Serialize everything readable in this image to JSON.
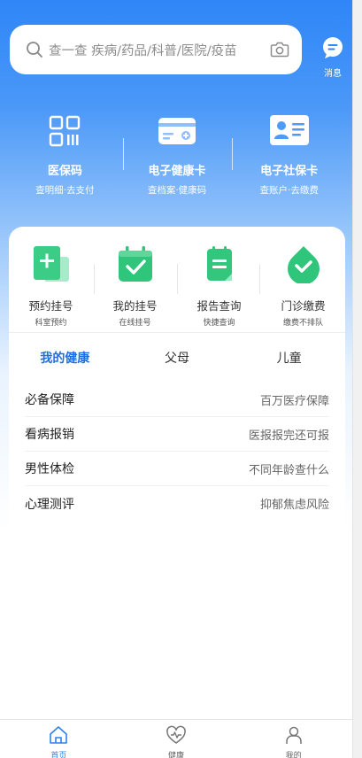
{
  "search": {
    "placeholder": "查一查 疾病/药品/科普/医院/疫苗"
  },
  "message": {
    "label": "消息"
  },
  "cards": [
    {
      "title": "医保码",
      "subtitle": "查明细·去支付",
      "icon": "qr-code-icon"
    },
    {
      "title": "电子健康卡",
      "subtitle": "查档案·健康码",
      "icon": "health-card-icon"
    },
    {
      "title": "电子社保卡",
      "subtitle": "查账户·去缴费",
      "icon": "social-security-card-icon"
    }
  ],
  "quick_actions": [
    {
      "title": "预约挂号",
      "subtitle": "科室预约",
      "icon": "appointment-icon"
    },
    {
      "title": "我的挂号",
      "subtitle": "在线挂号",
      "icon": "my-registration-icon"
    },
    {
      "title": "报告查询",
      "subtitle": "快捷查询",
      "icon": "report-icon"
    },
    {
      "title": "门诊缴费",
      "subtitle": "缴费不排队",
      "icon": "payment-icon"
    }
  ],
  "tabs": [
    {
      "label": "我的健康",
      "active": true
    },
    {
      "label": "父母",
      "active": false
    },
    {
      "label": "儿童",
      "active": false
    }
  ],
  "health_rows": [
    {
      "title": "必备保障",
      "desc": "百万医疗保障"
    },
    {
      "title": "看病报销",
      "desc": "医报报完还可报"
    },
    {
      "title": "男性体检",
      "desc": "不同年龄查什么"
    },
    {
      "title": "心理测评",
      "desc": "抑郁焦虑风险"
    }
  ],
  "bottom_nav": [
    {
      "label": "首页",
      "active": true,
      "icon": "home-icon"
    },
    {
      "label": "健康",
      "active": false,
      "icon": "heart-pulse-icon"
    },
    {
      "label": "我的",
      "active": false,
      "icon": "user-icon"
    }
  ],
  "colors": {
    "primary": "#2f86f7",
    "active_tab": "#1f6fe0",
    "green": "#34c77b"
  }
}
